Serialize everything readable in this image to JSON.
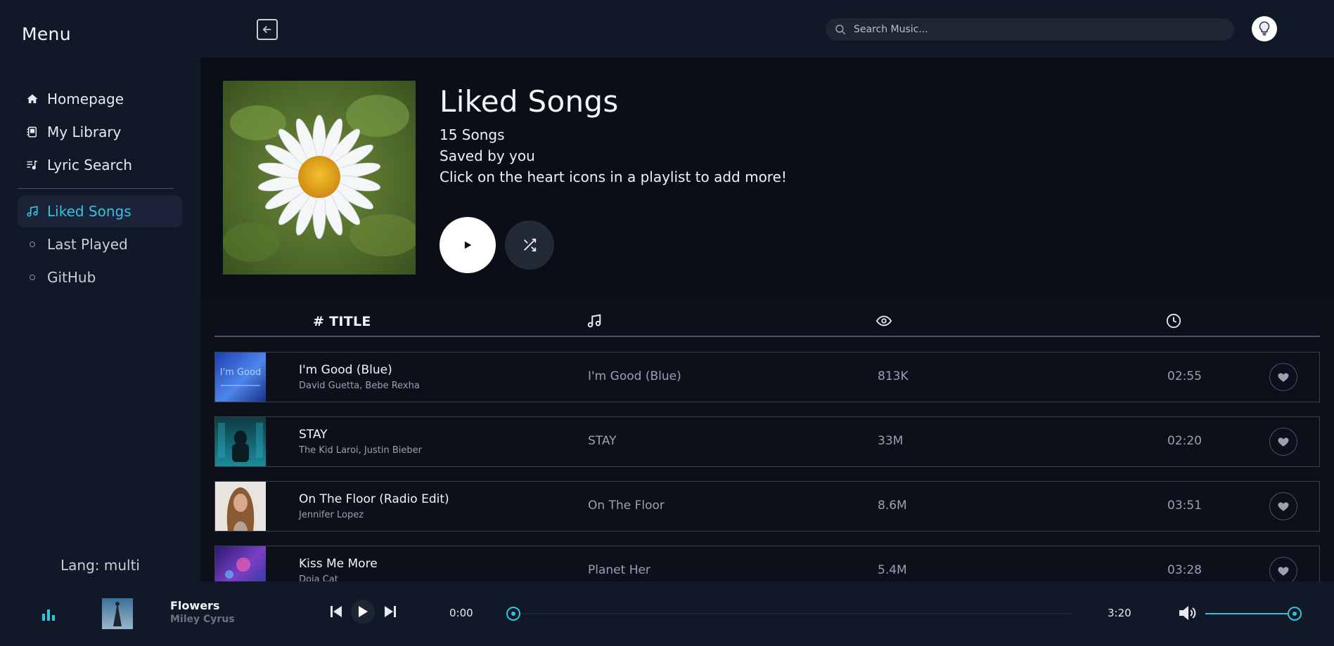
{
  "sidebar": {
    "title": "Menu",
    "nav": [
      {
        "label": "Homepage",
        "icon": "home-icon"
      },
      {
        "label": "My Library",
        "icon": "library-icon"
      },
      {
        "label": "Lyric Search",
        "icon": "lyric-search-icon"
      }
    ],
    "playlists": [
      {
        "label": "Liked Songs",
        "icon": "music-note-icon",
        "active": true
      },
      {
        "label": "Last Played",
        "icon": "circle-icon",
        "active": false
      },
      {
        "label": "GitHub",
        "icon": "circle-icon",
        "active": false
      }
    ],
    "lang": "Lang: multi"
  },
  "topbar": {
    "back_icon": "back-arrow-icon",
    "search_placeholder": "Search Music...",
    "avatar_icon": "lightbulb-avatar"
  },
  "hero": {
    "title": "Liked Songs",
    "count": "15 Songs",
    "saved_by": "Saved by you",
    "hint": "Click on the heart icons in a playlist to add more!"
  },
  "table": {
    "title_header": "# TITLE",
    "album_icon": "music-note-icon",
    "views_icon": "eye-icon",
    "duration_icon": "clock-icon",
    "rows": [
      {
        "title": "I'm Good (Blue)",
        "artist": "David Guetta, Bebe Rexha",
        "album": "I'm Good (Blue)",
        "views": "813K",
        "duration": "02:55",
        "thumb_color": "#2f5fd6",
        "thumb_text": "I'm Good"
      },
      {
        "title": "STAY",
        "artist": "The Kid Laroi, Justin Bieber",
        "album": "STAY",
        "views": "33M",
        "duration": "02:20",
        "thumb_color": "#1b6e7a"
      },
      {
        "title": "On The Floor (Radio Edit)",
        "artist": "Jennifer Lopez",
        "album": "On The Floor",
        "views": "8.6M",
        "duration": "03:51",
        "thumb_color": "#c9a98a"
      },
      {
        "title": "Kiss Me More",
        "artist": "Doja Cat",
        "album": "Planet Her",
        "views": "5.4M",
        "duration": "03:28",
        "thumb_color": "#5b3aa8"
      }
    ]
  },
  "player": {
    "title": "Flowers",
    "artist": "Miley Cyrus",
    "current_time": "0:00",
    "total_time": "3:20",
    "progress": 0,
    "volume": 1,
    "accent": "#33c3dd"
  }
}
